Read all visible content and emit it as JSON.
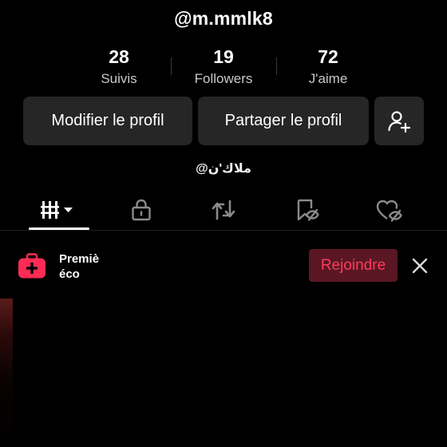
{
  "profile": {
    "username": "@m.mmlk8",
    "bio": "@ملاك'ن"
  },
  "stats": [
    {
      "value": "28",
      "label": "Suivis"
    },
    {
      "value": "19",
      "label": "Followers"
    },
    {
      "value": "72",
      "label": "J'aime"
    }
  ],
  "actions": {
    "edit_profile": "Modifier le profil",
    "share_profile": "Partager le profil",
    "add_friend_icon": "person-plus-icon"
  },
  "tabs": [
    {
      "icon": "grid-dropdown-icon",
      "active": true
    },
    {
      "icon": "lock-icon",
      "active": false
    },
    {
      "icon": "repost-icon",
      "active": false
    },
    {
      "icon": "bookmark-hidden-icon",
      "active": false
    },
    {
      "icon": "heart-hidden-icon",
      "active": false
    }
  ],
  "banner": {
    "icon": "premium-plus-icon",
    "line1": "Premiè",
    "line2": "éco",
    "join_label": "Rejoindre",
    "close_icon": "close-icon"
  },
  "colors": {
    "background": "#000000",
    "button_bg": "#262626",
    "accent": "#fe2c55",
    "join_bg": "#5a1723"
  }
}
